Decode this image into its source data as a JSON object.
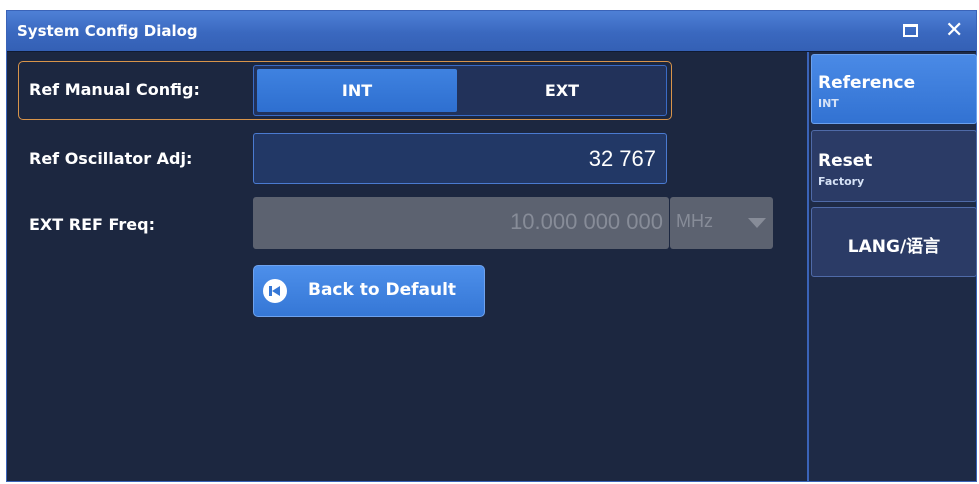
{
  "window": {
    "title": "System Config Dialog"
  },
  "rows": {
    "ref_manual_config": {
      "label": "Ref Manual Config:",
      "options": [
        "INT",
        "EXT"
      ],
      "selected": "INT"
    },
    "ref_oscillator_adj": {
      "label": "Ref Oscillator Adj:",
      "value": "32 767"
    },
    "ext_ref_freq": {
      "label": "EXT REF Freq:",
      "value": "10.000 000 000",
      "unit": "MHz",
      "enabled": false
    }
  },
  "back_button": {
    "label": "Back to Default"
  },
  "side_menu": {
    "reference": {
      "title": "Reference",
      "sub": "INT"
    },
    "reset": {
      "title": "Reset",
      "sub": "Factory"
    },
    "lang": {
      "title": "LANG/语言"
    }
  },
  "colors": {
    "accent": "#3a78d8",
    "highlight_border": "#d8944a",
    "background": "#1c2740"
  },
  "icons": [
    "maximize-icon",
    "close-icon",
    "chevron-down-icon",
    "back-to-default-icon"
  ]
}
